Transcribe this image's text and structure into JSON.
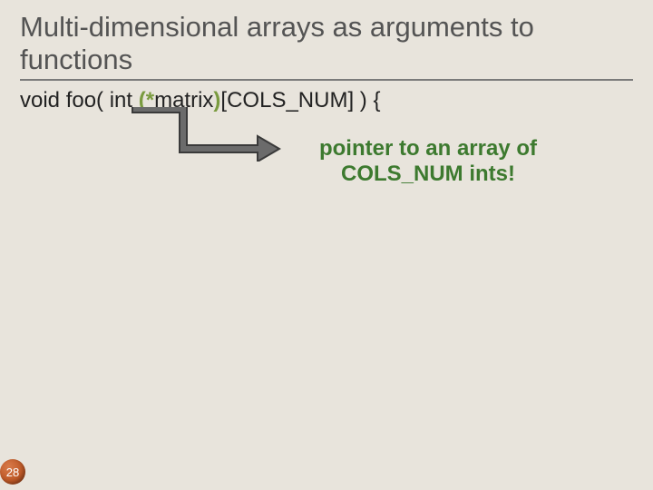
{
  "title": "Multi-dimensional arrays as arguments to functions",
  "code": {
    "pre": "void foo( int ",
    "lp": "(*",
    "mid": "matrix",
    "rp": ")",
    "post": "[COLS_NUM] ) {"
  },
  "annotation_line1": "pointer to an array of",
  "annotation_line2": "COLS_NUM ints!",
  "page_number": "28"
}
